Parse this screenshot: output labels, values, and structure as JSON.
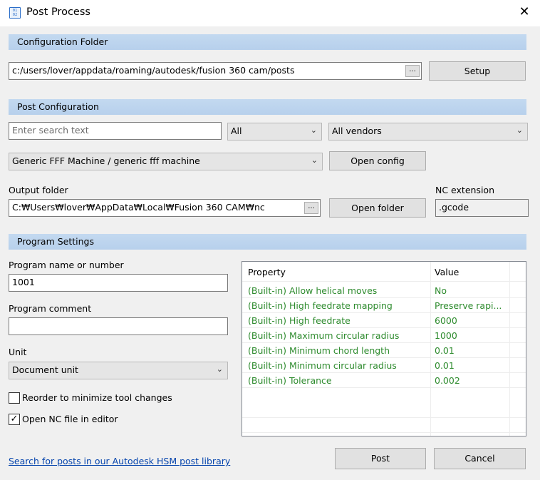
{
  "window": {
    "title": "Post Process",
    "icon": "document-icon"
  },
  "sections": {
    "config_folder": "Configuration Folder",
    "post_config": "Post Configuration",
    "program_settings": "Program Settings"
  },
  "config_folder": {
    "path": "c:/users/lover/appdata/roaming/autodesk/fusion 360 cam/posts",
    "browse": "...",
    "setup": "Setup"
  },
  "post_config": {
    "search_placeholder": "Enter search text",
    "filter_type": "All",
    "filter_vendor": "All vendors",
    "machine": "Generic FFF Machine / generic fff machine",
    "open_config": "Open config"
  },
  "output": {
    "label": "Output folder",
    "path": "C:₩Users₩lover₩AppData₩Local₩Fusion 360 CAM₩nc",
    "browse": "...",
    "open_folder": "Open folder",
    "ext_label": "NC extension",
    "ext_value": ".gcode"
  },
  "program": {
    "name_label": "Program name or number",
    "name_value": "1001",
    "comment_label": "Program comment",
    "comment_value": "",
    "unit_label": "Unit",
    "unit_value": "Document unit",
    "reorder_label": "Reorder to minimize tool changes",
    "reorder_checked": false,
    "open_nc_label": "Open NC file in editor",
    "open_nc_checked": true
  },
  "properties": {
    "col_property": "Property",
    "col_value": "Value",
    "rows": [
      {
        "name": "(Built-in) Allow helical moves",
        "value": "No"
      },
      {
        "name": "(Built-in) High feedrate mapping",
        "value": "Preserve rapi..."
      },
      {
        "name": "(Built-in) High feedrate",
        "value": "6000"
      },
      {
        "name": "(Built-in) Maximum circular radius",
        "value": "1000"
      },
      {
        "name": "(Built-in) Minimum chord length",
        "value": "0.01"
      },
      {
        "name": "(Built-in) Minimum circular radius",
        "value": "0.01"
      },
      {
        "name": "(Built-in) Tolerance",
        "value": "0.002"
      }
    ]
  },
  "footer": {
    "link": "Search for posts in our Autodesk HSM post library",
    "post": "Post",
    "cancel": "Cancel"
  },
  "colors": {
    "section_bar": "#bcd4ee",
    "property_text": "#2e8b2e",
    "link": "#0645ad"
  }
}
